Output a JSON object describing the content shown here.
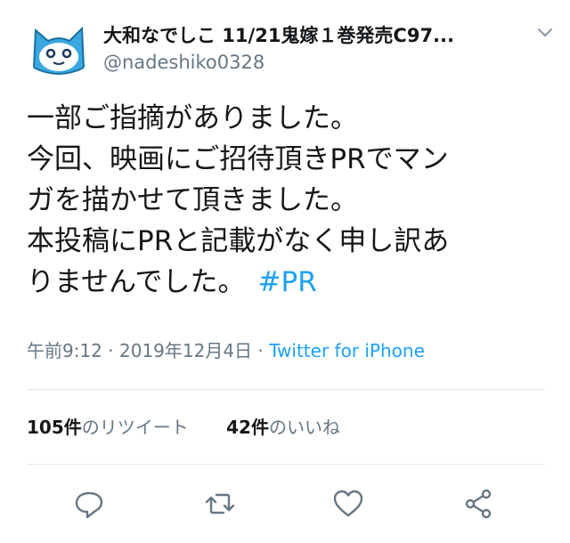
{
  "user": {
    "display_name": "大和なでしこ 11/21鬼嫁１巻発売C97...",
    "handle": "@nadeshiko0328"
  },
  "tweet": {
    "lines": [
      "一部ご指摘がありました。",
      "今回、映画にご招待頂きPRでマン",
      "ガを描かせて頂きました。",
      "本投稿にPRと記載がなく申し訳あ",
      "りませんでした。"
    ],
    "hashtag": "#PR"
  },
  "meta": {
    "time": "午前9:12 · 2019年12月4日 · ",
    "source": "Twitter for iPhone"
  },
  "stats": {
    "retweets_count": "105件",
    "retweets_label": "のリツイート",
    "likes_count": "42件",
    "likes_label": "のいいね"
  },
  "icons": [
    "avatar-cat",
    "chevron-down-icon",
    "reply-icon",
    "retweet-icon",
    "like-icon",
    "share-icon"
  ],
  "colors": {
    "accent": "#1da1f2",
    "muted": "#657786",
    "text": "#14171a",
    "divider": "#e1e8ed",
    "avatar_blue": "#3aa7e0"
  }
}
